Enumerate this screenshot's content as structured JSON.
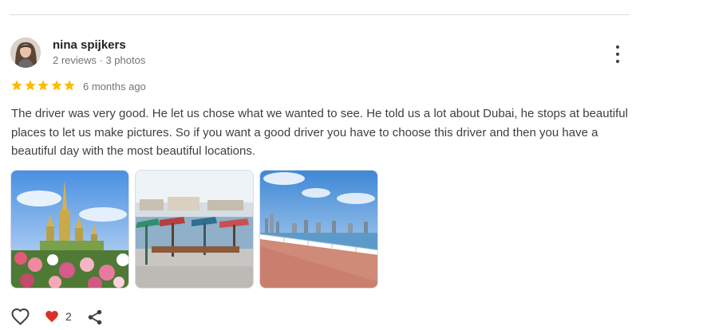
{
  "review": {
    "reviewer_name": "nina spijkers",
    "reviewer_meta": "2 reviews · 3 photos",
    "rating": 5,
    "time_ago": "6 months ago",
    "text": "The driver was very good. He let us chose what we wanted to see. He told us a lot about Dubai, he stops at beautiful places to let us make pictures. So if you want a good driver you have to choose this driver and then you have a beautiful day with the most beautiful locations.",
    "photos": [
      {
        "icon": "miracle-garden-castle-photo"
      },
      {
        "icon": "creek-abra-boats-photo"
      },
      {
        "icon": "marina-boardwalk-skyline-photo"
      }
    ]
  },
  "actions": {
    "like_icon": "heart-outline-icon",
    "reaction_icon": "heart-filled-icon",
    "reaction_count": "2",
    "share_icon": "share-icon"
  },
  "colors": {
    "star": "#fbbc04",
    "reaction_heart": "#d93025",
    "name": "#202124",
    "meta": "#70757a"
  }
}
